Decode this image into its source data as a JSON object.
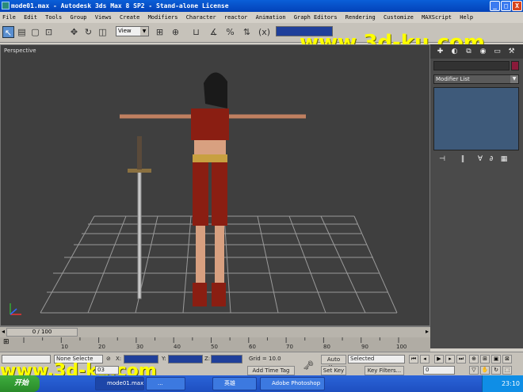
{
  "window": {
    "title": "mode01.max - Autodesk 3ds Max 8 SP2  - Stand-alone License"
  },
  "window_controls": {
    "minimize": "_",
    "maximize": "□",
    "close": "X"
  },
  "menu": [
    "File",
    "Edit",
    "Tools",
    "Group",
    "Views",
    "Create",
    "Modifiers",
    "Character",
    "reactor",
    "Animation",
    "Graph Editors",
    "Rendering",
    "Customize",
    "MAXScript",
    "Help"
  ],
  "toolbar": {
    "view_dropdown": "View",
    "watermark": "www.3d-ku.com"
  },
  "viewport": {
    "label": "Perspective"
  },
  "command_panel": {
    "modifier_list": "Modifier List",
    "colors": {
      "object_color": "#8a1a3a",
      "stack_bg": "#3e5a7a"
    }
  },
  "timeline": {
    "slider": "0 / 100",
    "ticks": [
      "10",
      "20",
      "30",
      "40",
      "50",
      "60",
      "70",
      "80",
      "90",
      "100"
    ]
  },
  "status": {
    "selection": "None Selecte",
    "x_label": "X:",
    "x_value": "",
    "y_label": "Y:",
    "y_value": "",
    "z_label": "Z:",
    "z_value": "",
    "grid": "Grid = 10.0",
    "add_time_tag": "Add Time Tag",
    "auto_key": "Auto Key",
    "auto_key_value": "Selected",
    "set_key": "Set Key",
    "key_filters": "Key Filters...",
    "frame": "0",
    "left_field": "03"
  },
  "taskbar": {
    "start": "开始",
    "tasks": [
      "mode01.max - ...",
      "...",
      "英雄",
      "Adobe Photoshop"
    ],
    "clock": "23:10"
  },
  "bottom_watermark": "www.3d-ku.com"
}
